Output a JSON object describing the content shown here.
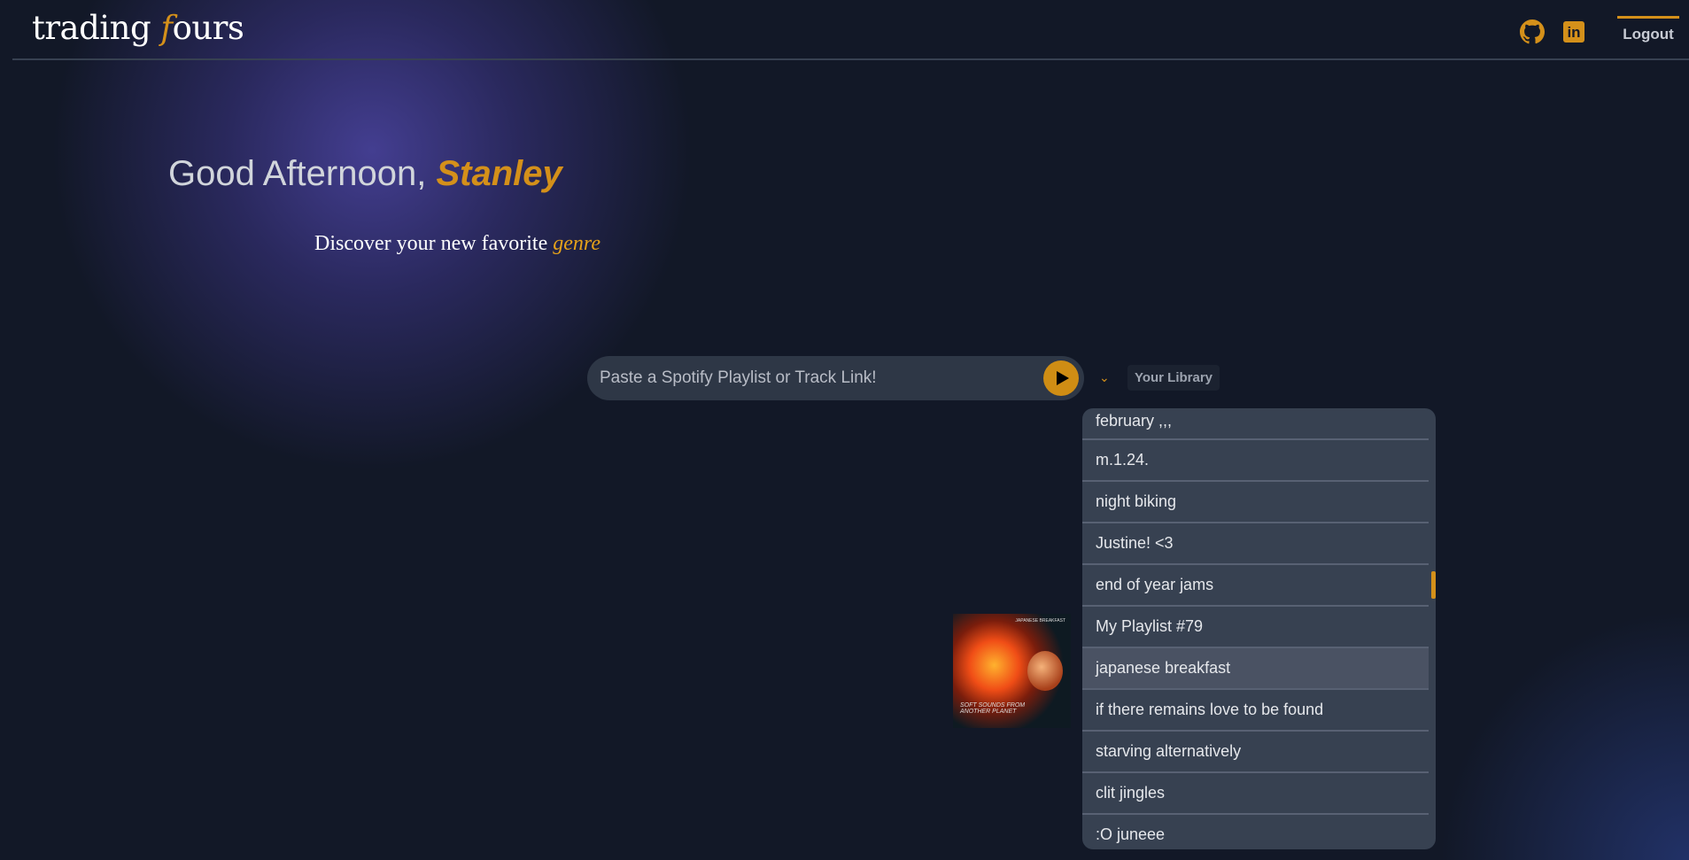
{
  "header": {
    "logo_prefix": "trading ",
    "logo_f": "f",
    "logo_suffix": "ours",
    "logout": "Logout",
    "icons": [
      "github-icon",
      "linkedin-icon"
    ]
  },
  "hero": {
    "greeting": "Good Afternoon, ",
    "name": "Stanley",
    "subtitle": "Discover your new favorite ",
    "subtitle_accent": "genre"
  },
  "search": {
    "placeholder": "Paste a Spotify Playlist or Track Link!",
    "value": ""
  },
  "library": {
    "label": "Your Library",
    "items": [
      "february ,,,",
      "m.1.24.",
      "night biking",
      "Justine! <3",
      "end of year jams",
      "My Playlist #79",
      "japanese breakfast",
      "if there remains love to be found",
      "starving alternatively",
      "clit jingles",
      ":O juneee"
    ],
    "hovered": "japanese breakfast"
  },
  "album": {
    "title": "SOFT SOUNDS FROM ANOTHER PLANET",
    "artist": "JAPANESE BREAKFAST"
  },
  "colors": {
    "accent": "#d4901a",
    "background": "#121827",
    "dropdown": "#374151"
  }
}
